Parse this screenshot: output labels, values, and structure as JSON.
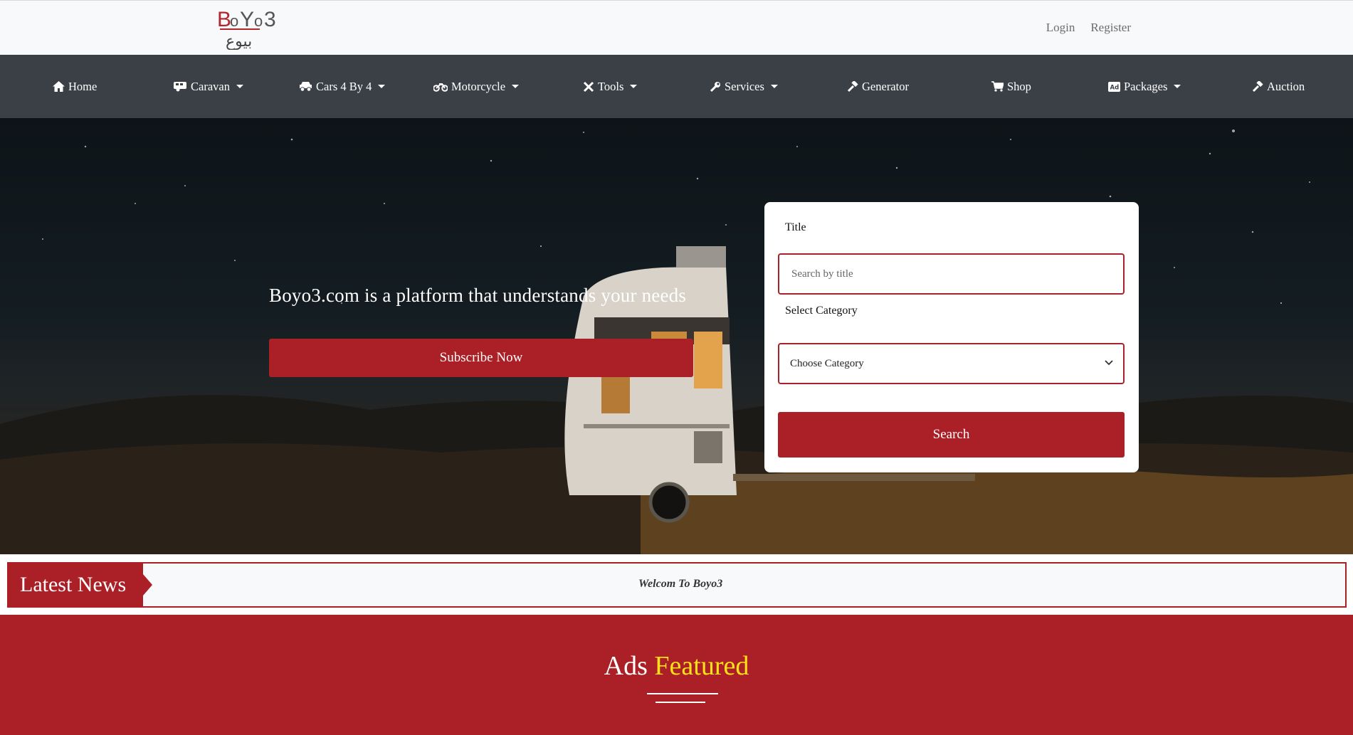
{
  "header": {
    "logo": {
      "latin": "BoYo3",
      "arabic": "بيوع"
    },
    "login_label": "Login",
    "register_label": "Register"
  },
  "nav": {
    "items": [
      {
        "label": "Home",
        "icon": "home-icon",
        "dropdown": false
      },
      {
        "label": "Caravan",
        "icon": "caravan-icon",
        "dropdown": true
      },
      {
        "label": "Cars 4 By 4",
        "icon": "car-icon",
        "dropdown": true
      },
      {
        "label": "Motorcycle",
        "icon": "motorcycle-icon",
        "dropdown": true
      },
      {
        "label": "Tools",
        "icon": "tools-icon",
        "dropdown": true
      },
      {
        "label": "Services",
        "icon": "wrench-icon",
        "dropdown": true
      },
      {
        "label": "Generator",
        "icon": "hammer-icon",
        "dropdown": false
      },
      {
        "label": "Shop",
        "icon": "cart-icon",
        "dropdown": false
      },
      {
        "label": "Packages",
        "icon": "ad-icon",
        "dropdown": true
      },
      {
        "label": "Auction",
        "icon": "gavel-icon",
        "dropdown": false
      }
    ]
  },
  "hero": {
    "tagline": "Boyo3.com is a platform that understands your needs",
    "subscribe_label": "Subscribe Now"
  },
  "search": {
    "title_label": "Title",
    "title_placeholder": "Search by title",
    "category_label": "Select Category",
    "category_value": "Choose Category",
    "button_label": "Search"
  },
  "news": {
    "tag": "Latest News",
    "text": "Welcom To Boyo3"
  },
  "featured": {
    "title_plain": "Ads",
    "title_highlight": "Featured"
  },
  "colors": {
    "brand_red": "#ab2026",
    "nav_bg": "#3b4047",
    "highlight_yellow": "#ffe11a"
  }
}
